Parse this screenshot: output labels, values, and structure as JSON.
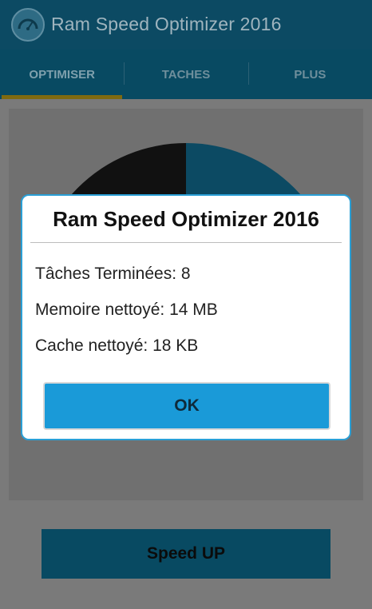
{
  "app": {
    "title": "Ram Speed Optimizer 2016",
    "icon": "speedometer-icon"
  },
  "tabs": [
    {
      "label": "OPTIMISER",
      "active": true
    },
    {
      "label": "TACHES",
      "active": false
    },
    {
      "label": "PLUS",
      "active": false
    }
  ],
  "main": {
    "gauge": {
      "type": "pie",
      "colors": [
        "#111111",
        "#0c4a63"
      ]
    },
    "speed_button_label": "Speed UP"
  },
  "dialog": {
    "title": "Ram Speed Optimizer 2016",
    "lines": [
      "Tâches Terminées: 8",
      "Memoire nettoyé: 14 MB",
      "Cache nettoyé: 18 KB"
    ],
    "ok_label": "OK"
  },
  "colors": {
    "app_bar": "#0c4a63",
    "tab_indicator": "#7f6a10",
    "dialog_border": "#2a9fd6",
    "ok_button": "#1a9ad8"
  }
}
